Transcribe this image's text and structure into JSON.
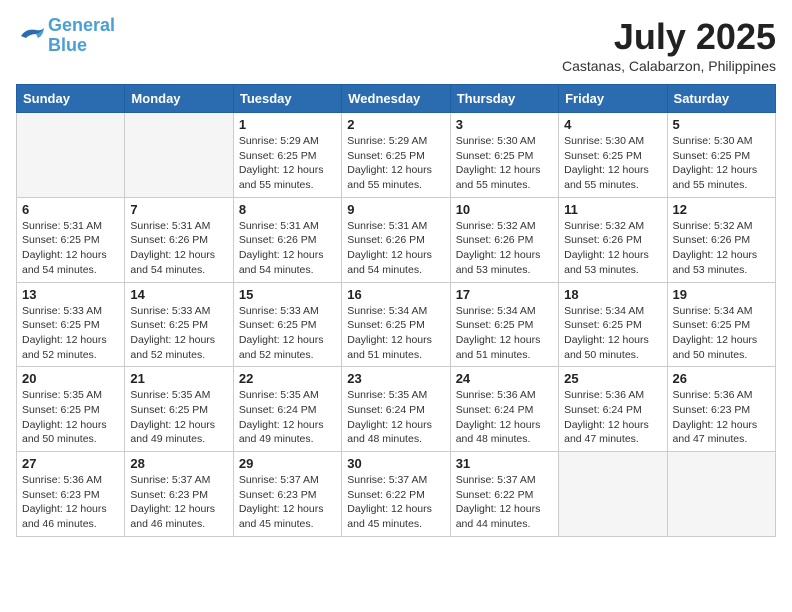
{
  "header": {
    "logo_line1": "General",
    "logo_line2": "Blue",
    "month_title": "July 2025",
    "subtitle": "Castanas, Calabarzon, Philippines"
  },
  "days_of_week": [
    "Sunday",
    "Monday",
    "Tuesday",
    "Wednesday",
    "Thursday",
    "Friday",
    "Saturday"
  ],
  "weeks": [
    [
      {
        "day": "",
        "info": ""
      },
      {
        "day": "",
        "info": ""
      },
      {
        "day": "1",
        "info": "Sunrise: 5:29 AM\nSunset: 6:25 PM\nDaylight: 12 hours\nand 55 minutes."
      },
      {
        "day": "2",
        "info": "Sunrise: 5:29 AM\nSunset: 6:25 PM\nDaylight: 12 hours\nand 55 minutes."
      },
      {
        "day": "3",
        "info": "Sunrise: 5:30 AM\nSunset: 6:25 PM\nDaylight: 12 hours\nand 55 minutes."
      },
      {
        "day": "4",
        "info": "Sunrise: 5:30 AM\nSunset: 6:25 PM\nDaylight: 12 hours\nand 55 minutes."
      },
      {
        "day": "5",
        "info": "Sunrise: 5:30 AM\nSunset: 6:25 PM\nDaylight: 12 hours\nand 55 minutes."
      }
    ],
    [
      {
        "day": "6",
        "info": "Sunrise: 5:31 AM\nSunset: 6:25 PM\nDaylight: 12 hours\nand 54 minutes."
      },
      {
        "day": "7",
        "info": "Sunrise: 5:31 AM\nSunset: 6:26 PM\nDaylight: 12 hours\nand 54 minutes."
      },
      {
        "day": "8",
        "info": "Sunrise: 5:31 AM\nSunset: 6:26 PM\nDaylight: 12 hours\nand 54 minutes."
      },
      {
        "day": "9",
        "info": "Sunrise: 5:31 AM\nSunset: 6:26 PM\nDaylight: 12 hours\nand 54 minutes."
      },
      {
        "day": "10",
        "info": "Sunrise: 5:32 AM\nSunset: 6:26 PM\nDaylight: 12 hours\nand 53 minutes."
      },
      {
        "day": "11",
        "info": "Sunrise: 5:32 AM\nSunset: 6:26 PM\nDaylight: 12 hours\nand 53 minutes."
      },
      {
        "day": "12",
        "info": "Sunrise: 5:32 AM\nSunset: 6:26 PM\nDaylight: 12 hours\nand 53 minutes."
      }
    ],
    [
      {
        "day": "13",
        "info": "Sunrise: 5:33 AM\nSunset: 6:25 PM\nDaylight: 12 hours\nand 52 minutes."
      },
      {
        "day": "14",
        "info": "Sunrise: 5:33 AM\nSunset: 6:25 PM\nDaylight: 12 hours\nand 52 minutes."
      },
      {
        "day": "15",
        "info": "Sunrise: 5:33 AM\nSunset: 6:25 PM\nDaylight: 12 hours\nand 52 minutes."
      },
      {
        "day": "16",
        "info": "Sunrise: 5:34 AM\nSunset: 6:25 PM\nDaylight: 12 hours\nand 51 minutes."
      },
      {
        "day": "17",
        "info": "Sunrise: 5:34 AM\nSunset: 6:25 PM\nDaylight: 12 hours\nand 51 minutes."
      },
      {
        "day": "18",
        "info": "Sunrise: 5:34 AM\nSunset: 6:25 PM\nDaylight: 12 hours\nand 50 minutes."
      },
      {
        "day": "19",
        "info": "Sunrise: 5:34 AM\nSunset: 6:25 PM\nDaylight: 12 hours\nand 50 minutes."
      }
    ],
    [
      {
        "day": "20",
        "info": "Sunrise: 5:35 AM\nSunset: 6:25 PM\nDaylight: 12 hours\nand 50 minutes."
      },
      {
        "day": "21",
        "info": "Sunrise: 5:35 AM\nSunset: 6:25 PM\nDaylight: 12 hours\nand 49 minutes."
      },
      {
        "day": "22",
        "info": "Sunrise: 5:35 AM\nSunset: 6:24 PM\nDaylight: 12 hours\nand 49 minutes."
      },
      {
        "day": "23",
        "info": "Sunrise: 5:35 AM\nSunset: 6:24 PM\nDaylight: 12 hours\nand 48 minutes."
      },
      {
        "day": "24",
        "info": "Sunrise: 5:36 AM\nSunset: 6:24 PM\nDaylight: 12 hours\nand 48 minutes."
      },
      {
        "day": "25",
        "info": "Sunrise: 5:36 AM\nSunset: 6:24 PM\nDaylight: 12 hours\nand 47 minutes."
      },
      {
        "day": "26",
        "info": "Sunrise: 5:36 AM\nSunset: 6:23 PM\nDaylight: 12 hours\nand 47 minutes."
      }
    ],
    [
      {
        "day": "27",
        "info": "Sunrise: 5:36 AM\nSunset: 6:23 PM\nDaylight: 12 hours\nand 46 minutes."
      },
      {
        "day": "28",
        "info": "Sunrise: 5:37 AM\nSunset: 6:23 PM\nDaylight: 12 hours\nand 46 minutes."
      },
      {
        "day": "29",
        "info": "Sunrise: 5:37 AM\nSunset: 6:23 PM\nDaylight: 12 hours\nand 45 minutes."
      },
      {
        "day": "30",
        "info": "Sunrise: 5:37 AM\nSunset: 6:22 PM\nDaylight: 12 hours\nand 45 minutes."
      },
      {
        "day": "31",
        "info": "Sunrise: 5:37 AM\nSunset: 6:22 PM\nDaylight: 12 hours\nand 44 minutes."
      },
      {
        "day": "",
        "info": ""
      },
      {
        "day": "",
        "info": ""
      }
    ]
  ]
}
